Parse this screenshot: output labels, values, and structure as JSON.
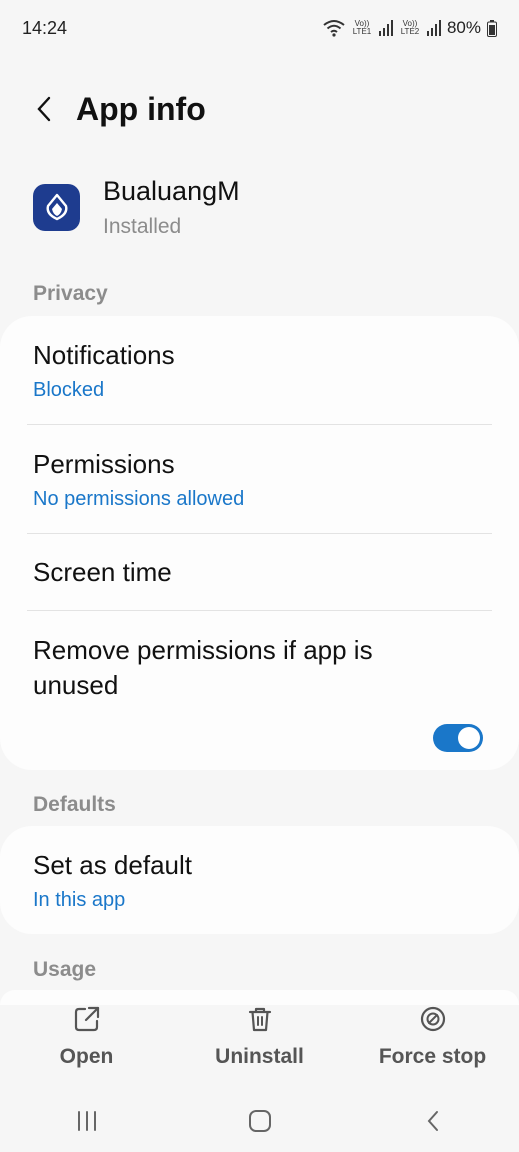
{
  "status_bar": {
    "time": "14:24",
    "sim1_label": "Vo)) LTE1",
    "sim2_label": "Vo)) LTE2",
    "battery": "80%",
    "icons": [
      "wifi-icon",
      "signal-icon",
      "battery-icon"
    ]
  },
  "header": {
    "title": "App info",
    "back_icon": "chevron-left-icon"
  },
  "app": {
    "name": "BualuangM",
    "status": "Installed",
    "icon_color": "#1e3c8f"
  },
  "sections": {
    "privacy": "Privacy",
    "defaults": "Defaults",
    "usage": "Usage"
  },
  "privacy_items": {
    "notifications_title": "Notifications",
    "notifications_value": "Blocked",
    "permissions_title": "Permissions",
    "permissions_value": "No permissions allowed",
    "screen_time_title": "Screen time",
    "remove_permissions_title": "Remove permissions if app is unused",
    "remove_permissions_enabled": true
  },
  "defaults_items": {
    "set_default_title": "Set as default",
    "set_default_value": "In this app"
  },
  "actions": {
    "open": "Open",
    "uninstall": "Uninstall",
    "force_stop": "Force stop"
  },
  "colors": {
    "accent": "#1a77c9",
    "background": "#f6f6f6",
    "card": "#fdfdfd",
    "muted": "#8c8c8c"
  },
  "nav": [
    "recents-icon",
    "home-icon",
    "back-icon"
  ]
}
